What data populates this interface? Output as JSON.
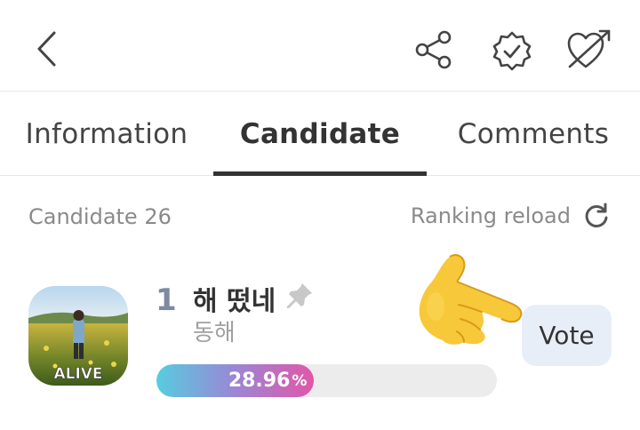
{
  "icons": {
    "back": "chevron-left-icon",
    "share": "share-icon",
    "badge": "verified-badge-icon",
    "heart": "heart-arrow-icon",
    "reload": "reload-icon",
    "pin": "pin-icon",
    "hand": "pointing-hand-emoji"
  },
  "tabs": [
    {
      "label": "Information",
      "active": false
    },
    {
      "label": "Candidate",
      "active": true
    },
    {
      "label": "Comments",
      "active": false
    }
  ],
  "list_header": {
    "count_label": "Candidate 26",
    "reload_label": "Ranking reload"
  },
  "candidate": {
    "rank": "1",
    "title": "해 떴네",
    "artist": "동해",
    "percent_value": "28.96",
    "percent_sign": "%",
    "percent_fraction": 0.2896,
    "album_art_text": "ALIVE",
    "vote_label": "Vote"
  },
  "colors": {
    "accent_gradient_start": "#56cde0",
    "accent_gradient_mid": "#9b86d4",
    "accent_gradient_end": "#e256a8",
    "vote_bg": "#e8eef8",
    "rank_color": "#7d8aa0"
  }
}
